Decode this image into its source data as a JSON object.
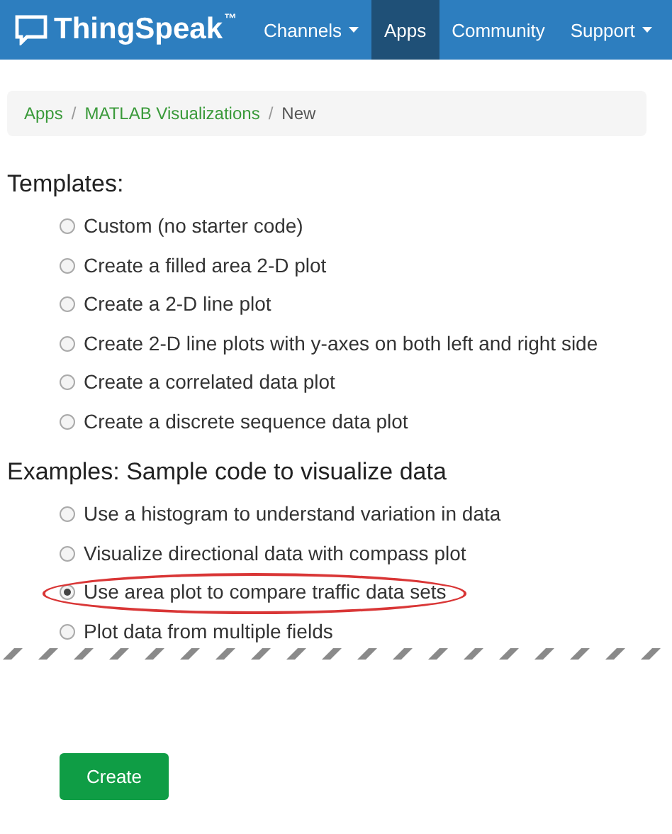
{
  "navbar": {
    "brand": "ThingSpeak",
    "brand_mark": "™",
    "items": [
      {
        "label": "Channels",
        "dropdown": true,
        "selected": false
      },
      {
        "label": "Apps",
        "dropdown": false,
        "selected": true
      },
      {
        "label": "Community",
        "dropdown": false,
        "selected": false
      },
      {
        "label": "Support",
        "dropdown": true,
        "selected": false
      }
    ]
  },
  "breadcrumb_separator": "/",
  "breadcrumb": [
    {
      "label": "Apps",
      "link": true
    },
    {
      "label": "MATLAB Visualizations",
      "link": true
    },
    {
      "label": "New",
      "link": false
    }
  ],
  "templates": {
    "heading": "Templates:",
    "options": [
      {
        "label": "Custom (no starter code)",
        "selected": false
      },
      {
        "label": "Create a filled area 2-D plot",
        "selected": false
      },
      {
        "label": "Create a 2-D line plot",
        "selected": false
      },
      {
        "label": "Create 2-D line plots with y-axes on both left and right side",
        "selected": false
      },
      {
        "label": "Create a correlated data plot",
        "selected": false
      },
      {
        "label": "Create a discrete sequence data plot",
        "selected": false
      }
    ]
  },
  "examples": {
    "heading": "Examples: Sample code to visualize data",
    "options": [
      {
        "label": "Use a histogram to understand variation in data",
        "selected": false,
        "circled": false
      },
      {
        "label": "Visualize directional data with compass plot",
        "selected": false,
        "circled": false
      },
      {
        "label": "Use area plot to compare traffic data sets",
        "selected": true,
        "circled": true
      },
      {
        "label": "Plot data from multiple fields",
        "selected": false,
        "circled": false
      }
    ]
  },
  "create_button": "Create"
}
